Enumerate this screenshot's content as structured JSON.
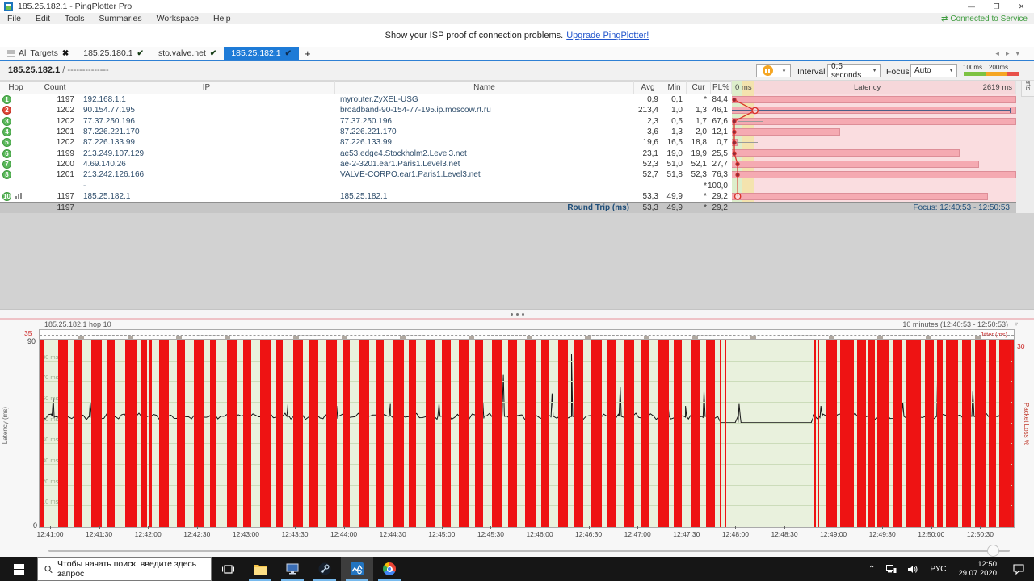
{
  "window": {
    "title": "185.25.182.1 - PingPlotter Pro",
    "minimize": "—",
    "maximize": "❐",
    "close": "✕"
  },
  "menu": {
    "items": [
      "File",
      "Edit",
      "Tools",
      "Summaries",
      "Workspace",
      "Help"
    ],
    "connected_icon": "⇄",
    "connected": "Connected to Service"
  },
  "banner": {
    "text": "Show your ISP proof of connection problems.",
    "link": "Upgrade PingPlotter!"
  },
  "tabs": {
    "all_targets": "All Targets",
    "close_glyph": "✖",
    "check_glyph": "✔",
    "items": [
      "185.25.180.1",
      "sto.valve.net",
      "185.25.182.1"
    ],
    "new_tab": "+",
    "nav_left": "◂",
    "nav_right": "▸",
    "nav_down": "▾"
  },
  "alerts_tab": "Alerts",
  "targetbar": {
    "target": "185.25.182.1",
    "suffix": "/ --------------",
    "interval_label": "Interval",
    "interval_value": "0,5 seconds",
    "focus_label": "Focus",
    "focus_value": "Auto",
    "legend": {
      "label_100": "100ms",
      "label_200": "200ms",
      "green": "#7dc242",
      "orange": "#f5a623",
      "red": "#e8514a"
    }
  },
  "table": {
    "headers": {
      "hop": "Hop",
      "count": "Count",
      "ip": "IP",
      "name": "Name",
      "avg": "Avg",
      "min": "Min",
      "cur": "Cur",
      "pl": "PL%"
    },
    "latency_header": {
      "left": "0 ms",
      "center": "Latency",
      "right": "2619 ms"
    },
    "scale_max_ms": 2619,
    "rows": [
      {
        "hop": "1",
        "dot": "green",
        "chart_icon": false,
        "count": "1197",
        "ip": "192.168.1.1",
        "name": "myrouter.ZyXEL-USG",
        "avg": "0,9",
        "min": "0,1",
        "cur": "*",
        "pl": "84,4",
        "bar_pct": 100,
        "avg_ms": 0.9,
        "marker": "dot",
        "whisker": null,
        "range_line": false
      },
      {
        "hop": "2",
        "dot": "red",
        "chart_icon": false,
        "count": "1202",
        "ip": "90.154.77.195",
        "name": "broadband-90-154-77-195.ip.moscow.rt.ru",
        "avg": "213,4",
        "min": "1,0",
        "cur": "1,3",
        "pl": "46,1",
        "bar_pct": 100,
        "avg_ms": 213.4,
        "marker": "circle",
        "whisker": null,
        "range_line": true
      },
      {
        "hop": "3",
        "dot": "green",
        "chart_icon": false,
        "count": "1202",
        "ip": "77.37.250.196",
        "name": "77.37.250.196",
        "avg": "2,3",
        "min": "0,5",
        "cur": "1,7",
        "pl": "67,6",
        "bar_pct": 100,
        "avg_ms": 2.3,
        "marker": "dot",
        "whisker": [
          2,
          11
        ],
        "range_line": false
      },
      {
        "hop": "4",
        "dot": "green",
        "chart_icon": false,
        "count": "1201",
        "ip": "87.226.221.170",
        "name": "87.226.221.170",
        "avg": "3,6",
        "min": "1,3",
        "cur": "2,0",
        "pl": "12,1",
        "bar_pct": 38,
        "avg_ms": 3.6,
        "marker": "dot",
        "whisker": null,
        "range_line": false
      },
      {
        "hop": "5",
        "dot": "green",
        "chart_icon": false,
        "count": "1202",
        "ip": "87.226.133.99",
        "name": "87.226.133.99",
        "avg": "19,6",
        "min": "16,5",
        "cur": "18,8",
        "pl": "0,7",
        "bar_pct": 2,
        "avg_ms": 19.6,
        "marker": "dot",
        "whisker": [
          1.5,
          9
        ],
        "range_line": false
      },
      {
        "hop": "6",
        "dot": "green",
        "chart_icon": false,
        "count": "1199",
        "ip": "213.249.107.129",
        "name": "ae53.edge4.Stockholm2.Level3.net",
        "avg": "23,1",
        "min": "19,0",
        "cur": "19,9",
        "pl": "25,5",
        "bar_pct": 80,
        "avg_ms": 23.1,
        "marker": "dot",
        "whisker": [
          1.5,
          8
        ],
        "range_line": false
      },
      {
        "hop": "7",
        "dot": "green",
        "chart_icon": false,
        "count": "1200",
        "ip": "4.69.140.26",
        "name": "ae-2-3201.ear1.Paris1.Level3.net",
        "avg": "52,3",
        "min": "51,0",
        "cur": "52,1",
        "pl": "27,7",
        "bar_pct": 87,
        "avg_ms": 52.3,
        "marker": "dot",
        "whisker": null,
        "range_line": false
      },
      {
        "hop": "8",
        "dot": "green",
        "chart_icon": false,
        "count": "1201",
        "ip": "213.242.126.166",
        "name": "VALVE-CORPO.ear1.Paris1.Level3.net",
        "avg": "52,7",
        "min": "51,8",
        "cur": "52,3",
        "pl": "76,3",
        "bar_pct": 100,
        "avg_ms": 52.7,
        "marker": "dot",
        "whisker": null,
        "range_line": false
      },
      {
        "hop": "",
        "dot": null,
        "chart_icon": false,
        "count": "",
        "ip": "-",
        "name": "",
        "avg": "",
        "min": "",
        "cur": "*",
        "pl": "100,0",
        "bar_pct": 0,
        "avg_ms": null,
        "marker": null,
        "whisker": null,
        "range_line": false
      },
      {
        "hop": "10",
        "dot": "green",
        "chart_icon": true,
        "count": "1197",
        "ip": "185.25.182.1",
        "name": "185.25.182.1",
        "avg": "53,3",
        "min": "49,9",
        "cur": "*",
        "pl": "29,2",
        "bar_pct": 90,
        "avg_ms": 53.3,
        "marker": "circle",
        "whisker": null,
        "range_line": false
      }
    ],
    "round_trip": {
      "count": "1197",
      "label": "Round Trip (ms)",
      "avg": "53,3",
      "min": "49,9",
      "cur": "*",
      "pl": "29,2",
      "focus": "Focus: 12:40:53 - 12:50:53"
    }
  },
  "timeline": {
    "title": "185.25.182.1 hop 10",
    "range": "10 minutes (12:40:53 - 12:50:53)",
    "range_arrow": "▿",
    "jitter_value": "35",
    "jitter_label": "Jitter (ms)",
    "y_max": "90",
    "y_min": "0",
    "pl_max": "30",
    "left_axis": "Latency (ms)",
    "right_axis": "Packet Loss %",
    "grid_labels": [
      "80 ms",
      "70 ms",
      "60 ms",
      "50 ms",
      "40 ms",
      "30 ms",
      "20 ms",
      "10 ms"
    ],
    "ticks": [
      "12:41:00",
      "12:41:30",
      "12:42:00",
      "12:42:30",
      "12:43:00",
      "12:43:30",
      "12:44:00",
      "12:44:30",
      "12:45:00",
      "12:45:30",
      "12:46:00",
      "12:46:30",
      "12:47:00",
      "12:47:30",
      "12:48:00",
      "12:48:30",
      "12:49:00",
      "12:49:30",
      "12:50:00",
      "12:50:30"
    ],
    "tick_start_pct": 1.16,
    "tick_step_pct": 5.025,
    "latency_base_ms": 53,
    "flat_zone_pct": [
      69.6,
      79.3
    ],
    "loss_bars": [
      [
        0.05,
        0.45
      ],
      [
        1.9,
        1.0
      ],
      [
        3.6,
        0.8
      ],
      [
        5.3,
        1.1
      ],
      [
        7.0,
        0.7
      ],
      [
        8.8,
        1.2
      ],
      [
        10.4,
        0.6
      ],
      [
        11.2,
        0.35
      ],
      [
        12.3,
        1.0
      ],
      [
        14.1,
        0.8
      ],
      [
        15.8,
        1.15
      ],
      [
        17.5,
        0.7
      ],
      [
        19.2,
        1.0
      ],
      [
        20.9,
        0.85
      ],
      [
        22.6,
        1.2
      ],
      [
        24.3,
        0.7
      ],
      [
        26.0,
        1.0
      ],
      [
        27.7,
        0.9
      ],
      [
        29.4,
        1.15
      ],
      [
        31.1,
        0.75
      ],
      [
        32.8,
        1.05
      ],
      [
        34.5,
        0.85
      ],
      [
        36.2,
        1.2
      ],
      [
        37.9,
        0.7
      ],
      [
        39.6,
        1.0
      ],
      [
        41.3,
        0.9
      ],
      [
        43.0,
        1.1
      ],
      [
        44.7,
        0.8
      ],
      [
        46.4,
        1.05
      ],
      [
        48.1,
        0.9
      ],
      [
        49.8,
        1.2
      ],
      [
        51.5,
        0.75
      ],
      [
        53.2,
        1.0
      ],
      [
        54.9,
        0.9
      ],
      [
        56.6,
        1.15
      ],
      [
        58.3,
        0.8
      ],
      [
        60.0,
        1.05
      ],
      [
        61.7,
        0.9
      ],
      [
        63.4,
        1.2
      ],
      [
        65.1,
        0.8
      ],
      [
        66.8,
        1.0
      ],
      [
        68.4,
        0.9
      ],
      [
        69.8,
        0.15
      ],
      [
        70.3,
        0.15
      ],
      [
        79.5,
        0.15
      ],
      [
        79.9,
        0.15
      ],
      [
        80.7,
        1.1
      ],
      [
        82.2,
        1.4
      ],
      [
        83.9,
        0.9
      ],
      [
        85.1,
        0.6
      ],
      [
        86.0,
        1.2
      ],
      [
        87.6,
        0.9
      ],
      [
        89.0,
        1.5
      ],
      [
        90.9,
        0.9
      ],
      [
        92.1,
        0.6
      ],
      [
        93.0,
        1.3
      ],
      [
        94.7,
        0.9
      ],
      [
        96.0,
        1.1
      ],
      [
        97.4,
        0.8
      ],
      [
        98.5,
        1.2
      ],
      [
        99.8,
        0.2
      ]
    ],
    "spikes": [
      [
        1.4,
        62
      ],
      [
        2.6,
        74
      ],
      [
        5.2,
        60
      ],
      [
        9.0,
        59
      ],
      [
        13.0,
        58
      ],
      [
        18.0,
        68
      ],
      [
        21.5,
        60
      ],
      [
        23.2,
        62
      ],
      [
        25.5,
        59
      ],
      [
        28.0,
        61
      ],
      [
        30.5,
        58
      ],
      [
        33.6,
        64
      ],
      [
        36.0,
        59
      ],
      [
        38.2,
        61
      ],
      [
        41.0,
        59
      ],
      [
        43.2,
        80
      ],
      [
        45.5,
        60
      ],
      [
        47.6,
        73
      ],
      [
        50.6,
        66
      ],
      [
        52.6,
        64
      ],
      [
        54.6,
        83
      ],
      [
        57.0,
        70
      ],
      [
        59.6,
        67
      ],
      [
        62.0,
        60
      ],
      [
        64.5,
        59
      ],
      [
        66.3,
        58
      ],
      [
        68.2,
        65
      ],
      [
        71.8,
        59
      ],
      [
        80.2,
        58
      ],
      [
        84.2,
        70
      ],
      [
        88.6,
        60
      ],
      [
        92.2,
        78
      ],
      [
        95.8,
        65
      ],
      [
        98.0,
        58
      ]
    ],
    "jitter_marks": [
      4,
      9,
      14,
      19,
      26,
      31,
      37,
      44,
      50,
      56,
      62,
      67,
      73,
      81,
      86,
      91,
      96
    ]
  },
  "taskbar": {
    "search_placeholder": "Чтобы начать поиск, введите здесь запрос",
    "lang": "РУС",
    "time": "12:50",
    "date": "29.07.2020",
    "tray_chevron": "⌃"
  }
}
